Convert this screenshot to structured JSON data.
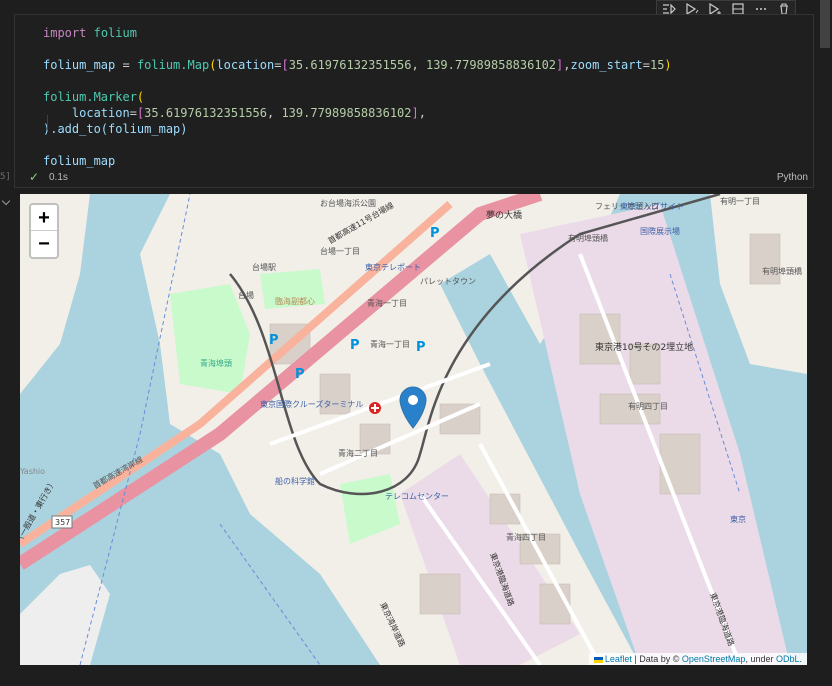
{
  "cell": {
    "code": {
      "line1_kw": "import",
      "line1_mod": "folium",
      "line3_var": "folium_map",
      "line3_op": " = ",
      "line3_call": "folium.Map",
      "line3_arg": "location",
      "line3_lat": "35.61976132351556",
      "line3_lon": "139.77989858836102",
      "line3_zoomkw": "zoom_start",
      "line3_zoom": "15",
      "line5_call": "folium.Marker",
      "line6_arg": "location",
      "line6_lat": "35.61976132351556",
      "line6_lon": "139.77989858836102",
      "line7": ").add_to(folium_map)",
      "line9": "folium_map"
    },
    "exec_time": "0.1s",
    "language": "Python",
    "gutter_label": "5]"
  },
  "toolbar": {
    "icons": [
      "run-by-line-icon",
      "execute-above-icon",
      "execute-below-icon",
      "split-cell-icon",
      "more-icon",
      "delete-icon"
    ]
  },
  "map": {
    "zoom_in": "+",
    "zoom_out": "−",
    "labels": {
      "odaiba_marine_park": "お台場海浜公園",
      "daiba_itchome": "台場一丁目",
      "daiba_station": "台場駅",
      "daiba": "台場",
      "fukutoshin": "臨海副都心",
      "tv": "東京テレポート",
      "pallet": "パレットタウン",
      "yume": "夢の大橋",
      "ariake": "有明埠頭橋",
      "aomi1": "青海一丁目",
      "aomi1b": "青海一丁目",
      "aomi2": "青海二丁目",
      "aomi4": "青海四丁目",
      "teleport": "テレコムセンター",
      "cruise": "東京国際クルーズターミナル",
      "fune": "船の科学館",
      "tokyo_port": "東京港10号その2埋立地",
      "ariake4": "有明四丁目",
      "ariake1": "有明一丁目",
      "ferry": "フェリー埠頭入口",
      "big_sight": "東京ビッグサイト",
      "shinkiba": "有明埠頭橋",
      "aomi_fu": "青海埠頭",
      "kasai": "首都高速湾岸線",
      "sea_park": "東京湾岸道路",
      "expressway": "首都高速11号台場線",
      "route357": "357",
      "yashio": "Yashio",
      "tokyo_east": "東京",
      "shinkaitou": "東京港臨海道路",
      "tokyo_port_line": "東京港臨海道路",
      "kokusai": "国際展示場",
      "side_route": "（一般道・東行き）"
    }
  },
  "attribution": {
    "leaflet": "Leaflet",
    "data_by": " | Data by © ",
    "osm": "OpenStreetMap",
    "under": ", under ",
    "odbl": "ODbL",
    "end": "."
  },
  "colors": {
    "water": "#aad3df",
    "land": "#f2efe9",
    "industrial": "#ebdbe8",
    "park": "#c8facc",
    "motorway": "#e892a2",
    "trunk": "#f9b29c",
    "marker": "#2a81cb"
  }
}
